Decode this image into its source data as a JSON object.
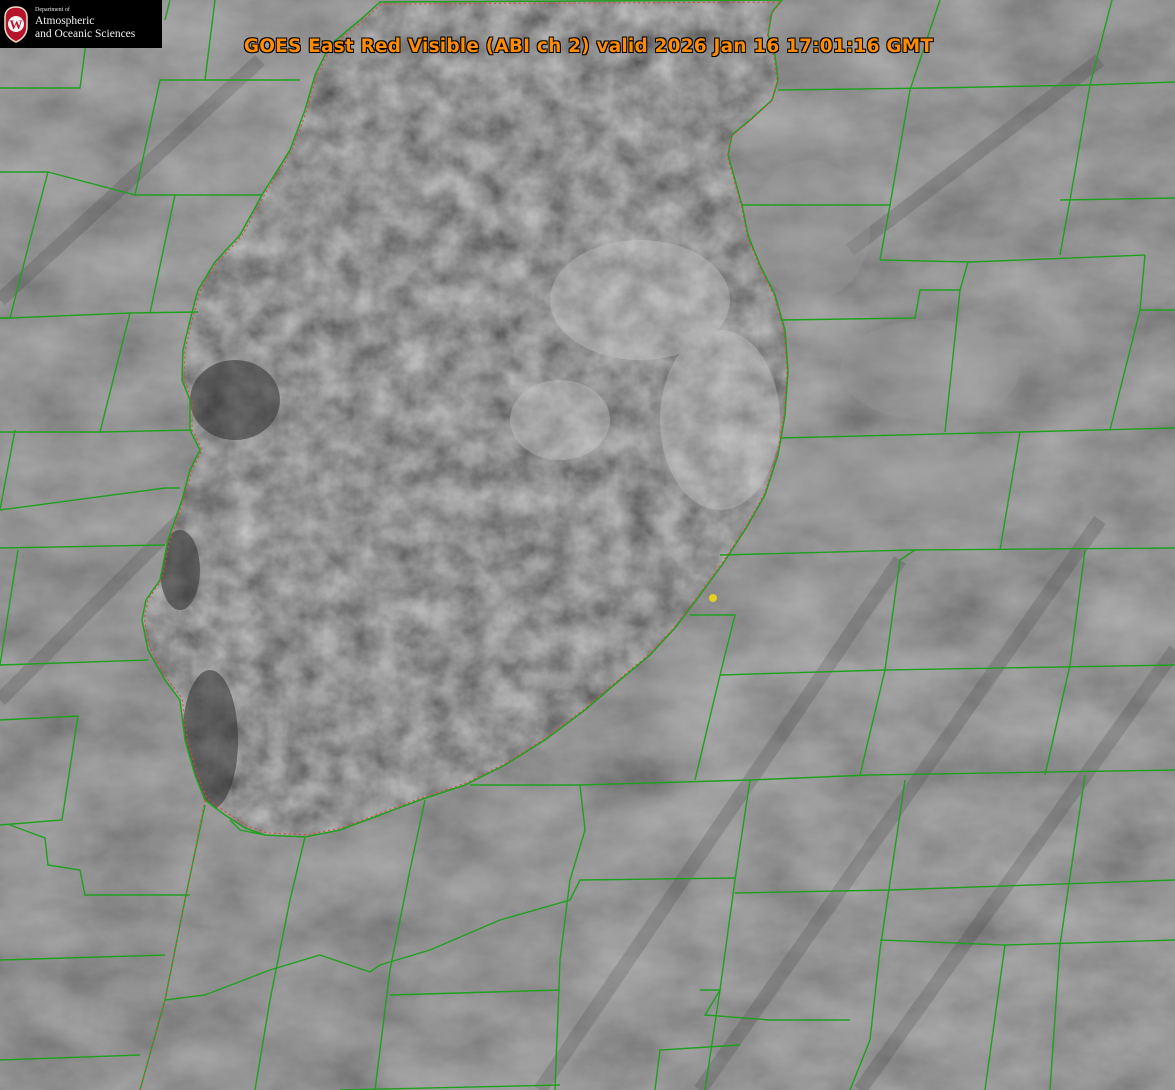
{
  "title": "GOES East Red Visible (ABI ch 2) valid 2026 Jan 16 17:01:16 GMT",
  "logo": {
    "dept_line1": "Department of",
    "line1": "Atmospheric",
    "line2": "and Oceanic Sciences",
    "shield_letter": "W"
  },
  "colors": {
    "title": "#ff8c00",
    "county_lines": "#1fa01f",
    "coastline_dashed": "#e0453a",
    "marker": "#e6d21e",
    "logo_red": "#b5142b"
  },
  "layers": [
    "visible-satellite-imagery",
    "county-boundaries",
    "lake-shoreline",
    "station-marker"
  ]
}
